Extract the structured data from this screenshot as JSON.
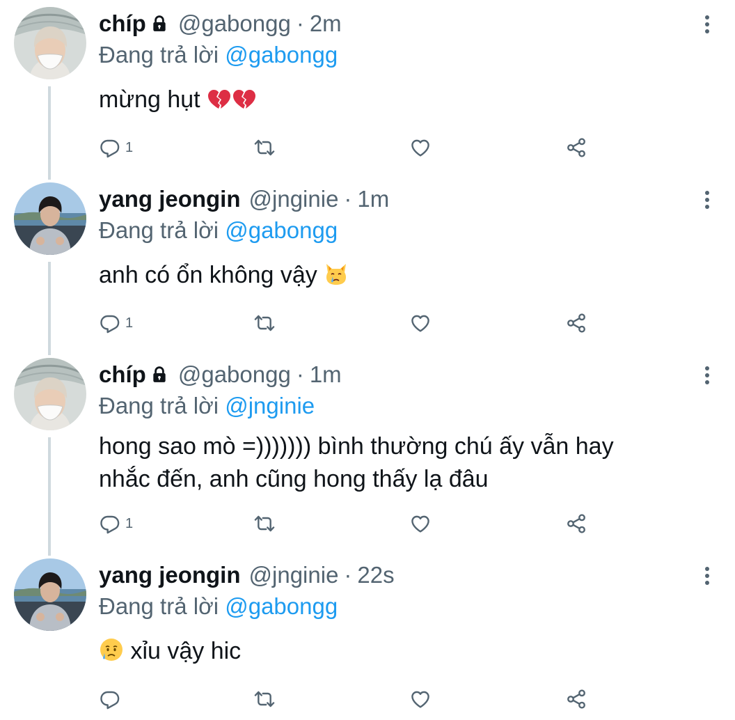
{
  "thread": {
    "reply_prefix": "Đang trả lời",
    "tweets": [
      {
        "author": "chíp",
        "protected": true,
        "handle": "@gabongg",
        "separator": "·",
        "time": "2m",
        "reply_to": "@gabongg",
        "text": "mừng hụt",
        "emoji": "broken-heart x2",
        "reply_count": "1"
      },
      {
        "author": "yang jeongin",
        "protected": false,
        "handle": "@jnginie",
        "separator": "·",
        "time": "1m",
        "reply_to": "@gabongg",
        "text": "anh có ổn không vậy",
        "emoji": "crying-cat-face",
        "reply_count": "1"
      },
      {
        "author": "chíp",
        "protected": true,
        "handle": "@gabongg",
        "separator": "·",
        "time": "1m",
        "reply_to": "@jnginie",
        "text_line1": "hong sao mò =))))))) bình thường chú ấy vẫn hay",
        "text_line2": "nhắc đến, anh cũng hong thấy lạ đâu",
        "reply_count": "1"
      },
      {
        "author": "yang jeongin",
        "protected": false,
        "handle": "@jnginie",
        "separator": "·",
        "time": "22s",
        "reply_to": "@gabongg",
        "text": "xỉu vậy hic",
        "emoji": "crying-face",
        "reply_count": ""
      }
    ]
  },
  "colors": {
    "text": "#0f1419",
    "secondary": "#536471",
    "accent": "#1d9bf0",
    "thread_line": "#cfd9de",
    "heart_red": "#dd2e44"
  },
  "icons": {
    "reply": "reply-icon",
    "retweet": "retweet-icon",
    "like": "like-icon",
    "share": "share-icon",
    "more": "more-vertical-icon",
    "lock": "lock-icon"
  }
}
